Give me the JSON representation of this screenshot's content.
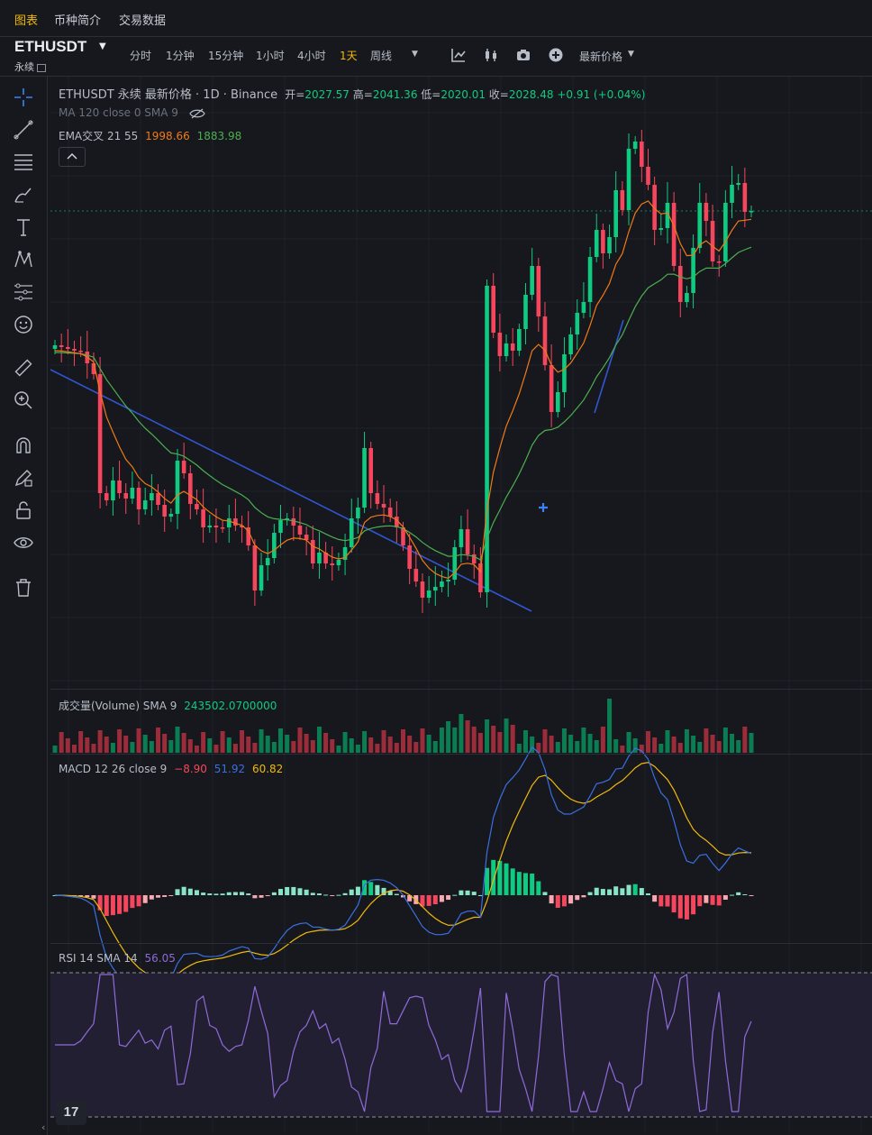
{
  "nav": {
    "tabs": [
      "图表",
      "币种简介",
      "交易数据"
    ],
    "active_tab": 0
  },
  "toolbar": {
    "symbol": "ETHUSDT",
    "contract": "永续",
    "intervals": [
      "分时",
      "1分钟",
      "15分钟",
      "1小时",
      "4小时",
      "1天",
      "周线"
    ],
    "active_interval": 5,
    "price_type": "最新价格"
  },
  "legend": {
    "main_title": "ETHUSDT 永续 最新价格 · 1D · Binance",
    "open_label": "开=",
    "open": "2027.57",
    "high_label": "高=",
    "high": "2041.36",
    "low_label": "低=",
    "low": "2020.01",
    "close_label": "收=",
    "close": "2028.48",
    "change": "+0.91 (+0.04%)",
    "ma_label": "MA 120 close 0 SMA 9",
    "ema_label": "EMA交叉 21 55",
    "ema_fast": "1998.66",
    "ema_slow": "1883.98",
    "volume_label": "成交量(Volume) SMA 9",
    "volume_value": "243502.0700000",
    "macd_label": "MACD 12 26 close 9",
    "macd_hist": "−8.90",
    "macd_line": "51.92",
    "macd_signal": "60.82",
    "rsi_label": "RSI 14 SMA 14",
    "rsi_value": "56.05"
  },
  "logo_text": "17",
  "colors": {
    "up": "#0ecb81",
    "down": "#f6465d",
    "ema_fast": "#f07a17",
    "ema_slow": "#4caf50",
    "accent": "#f0b90b",
    "macd_line": "#3b6fe0",
    "rsi": "#8e6bd8"
  },
  "icons": [
    "crosshair-icon",
    "trendline-icon",
    "fib-icon",
    "brush-icon",
    "text-icon",
    "pattern-icon",
    "prediction-icon",
    "emoji-icon",
    "ruler-icon",
    "zoom-icon",
    "magnet-icon",
    "lock-drawing-icon",
    "unlock-icon",
    "eye-icon",
    "trash-icon",
    "indicator-icon",
    "candle-type-icon",
    "camera-icon",
    "add-icon"
  ]
}
